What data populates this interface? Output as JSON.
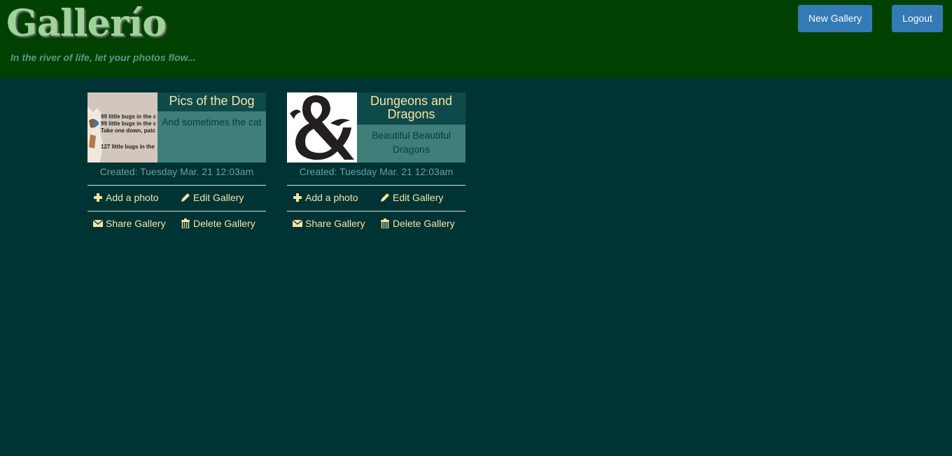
{
  "header": {
    "logo": "Gallerío",
    "tagline": "In the river of life, let your photos flow...",
    "new_gallery_label": "New Gallery",
    "logout_label": "Logout"
  },
  "galleries": [
    {
      "title": "Pics of the Dog",
      "description": "And sometimes the cat",
      "created": "Created: Tuesday Mar. 21 12:03am",
      "thumb_lines": [
        "99 little bugs in the c",
        "99 little bugs in the c",
        "Take one down, patc",
        "127 little bugs in the"
      ],
      "actions": {
        "add_photo": "Add a photo",
        "edit": "Edit Gallery",
        "share": "Share Gallery",
        "delete": "Delete Gallery"
      }
    },
    {
      "title": "Dungeons and Dragons",
      "description": "Beautiful Beautiful Dragons",
      "created": "Created: Tuesday Mar. 21 12:03am",
      "actions": {
        "add_photo": "Add a photo",
        "edit": "Edit Gallery",
        "share": "Share Gallery",
        "delete": "Delete Gallery"
      }
    }
  ],
  "colors": {
    "header_bg": "#004000",
    "page_bg": "#003333",
    "button_bg": "#337ab7",
    "accent_text": "#f7e4a6"
  },
  "icons": {
    "add": "plus-icon",
    "edit": "pencil-icon",
    "share": "envelope-icon",
    "delete": "trash-icon"
  }
}
